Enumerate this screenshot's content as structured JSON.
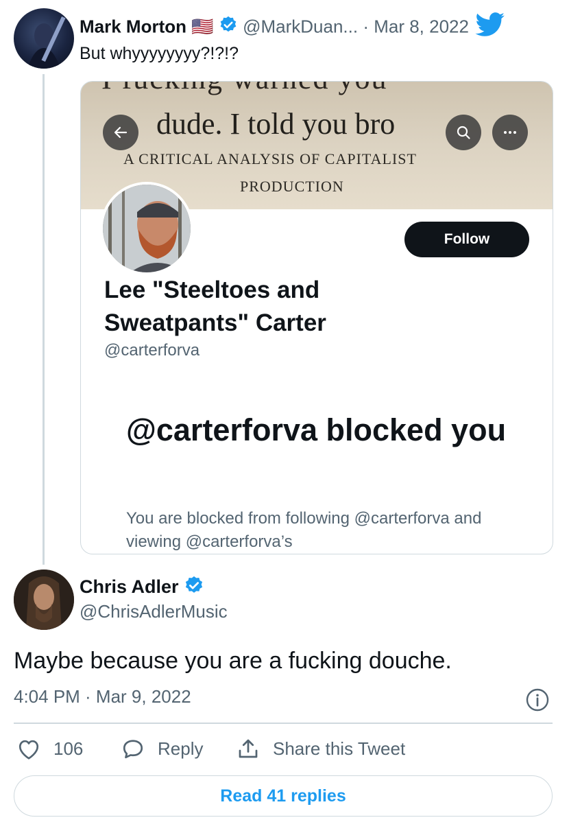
{
  "tweet1": {
    "author_name": "Mark Morton",
    "flag": "🇺🇸",
    "handle": "@MarkDuan...",
    "separator": "·",
    "date": "Mar 8, 2022",
    "text": "But whyyyyyyyy?!?!?"
  },
  "embed": {
    "banner_top": "I fucking warned you",
    "banner_line1": "dude. I told you bro",
    "banner_line2": "A CRITICAL ANALYSIS OF CAPITALIST",
    "banner_line3": "PRODUCTION",
    "follow_label": "Follow",
    "profile_name": "Lee \"Steeltoes and Sweatpants\" Carter",
    "profile_handle": "@carterforva",
    "blocked_title": "@carterforva blocked you",
    "blocked_desc": "You are blocked from following @carterforva and viewing @carterforva’s"
  },
  "tweet2": {
    "author_name": "Chris Adler",
    "handle": "@ChrisAdlerMusic",
    "text": "Maybe because you are a fucking douche.",
    "timestamp": "4:04 PM · Mar 9, 2022"
  },
  "actions": {
    "like_count": "106",
    "reply_label": "Reply",
    "share_label": "Share this Tweet",
    "read_replies_label": "Read 41 replies"
  },
  "colors": {
    "accent": "#1d9bf0",
    "text": "#0f1419",
    "secondary": "#536471",
    "border": "#cfd9de"
  },
  "icons": [
    "twitter-bird-icon",
    "verified-badge-icon",
    "back-arrow-icon",
    "search-icon",
    "more-icon",
    "info-icon",
    "heart-icon",
    "reply-icon",
    "share-icon"
  ]
}
